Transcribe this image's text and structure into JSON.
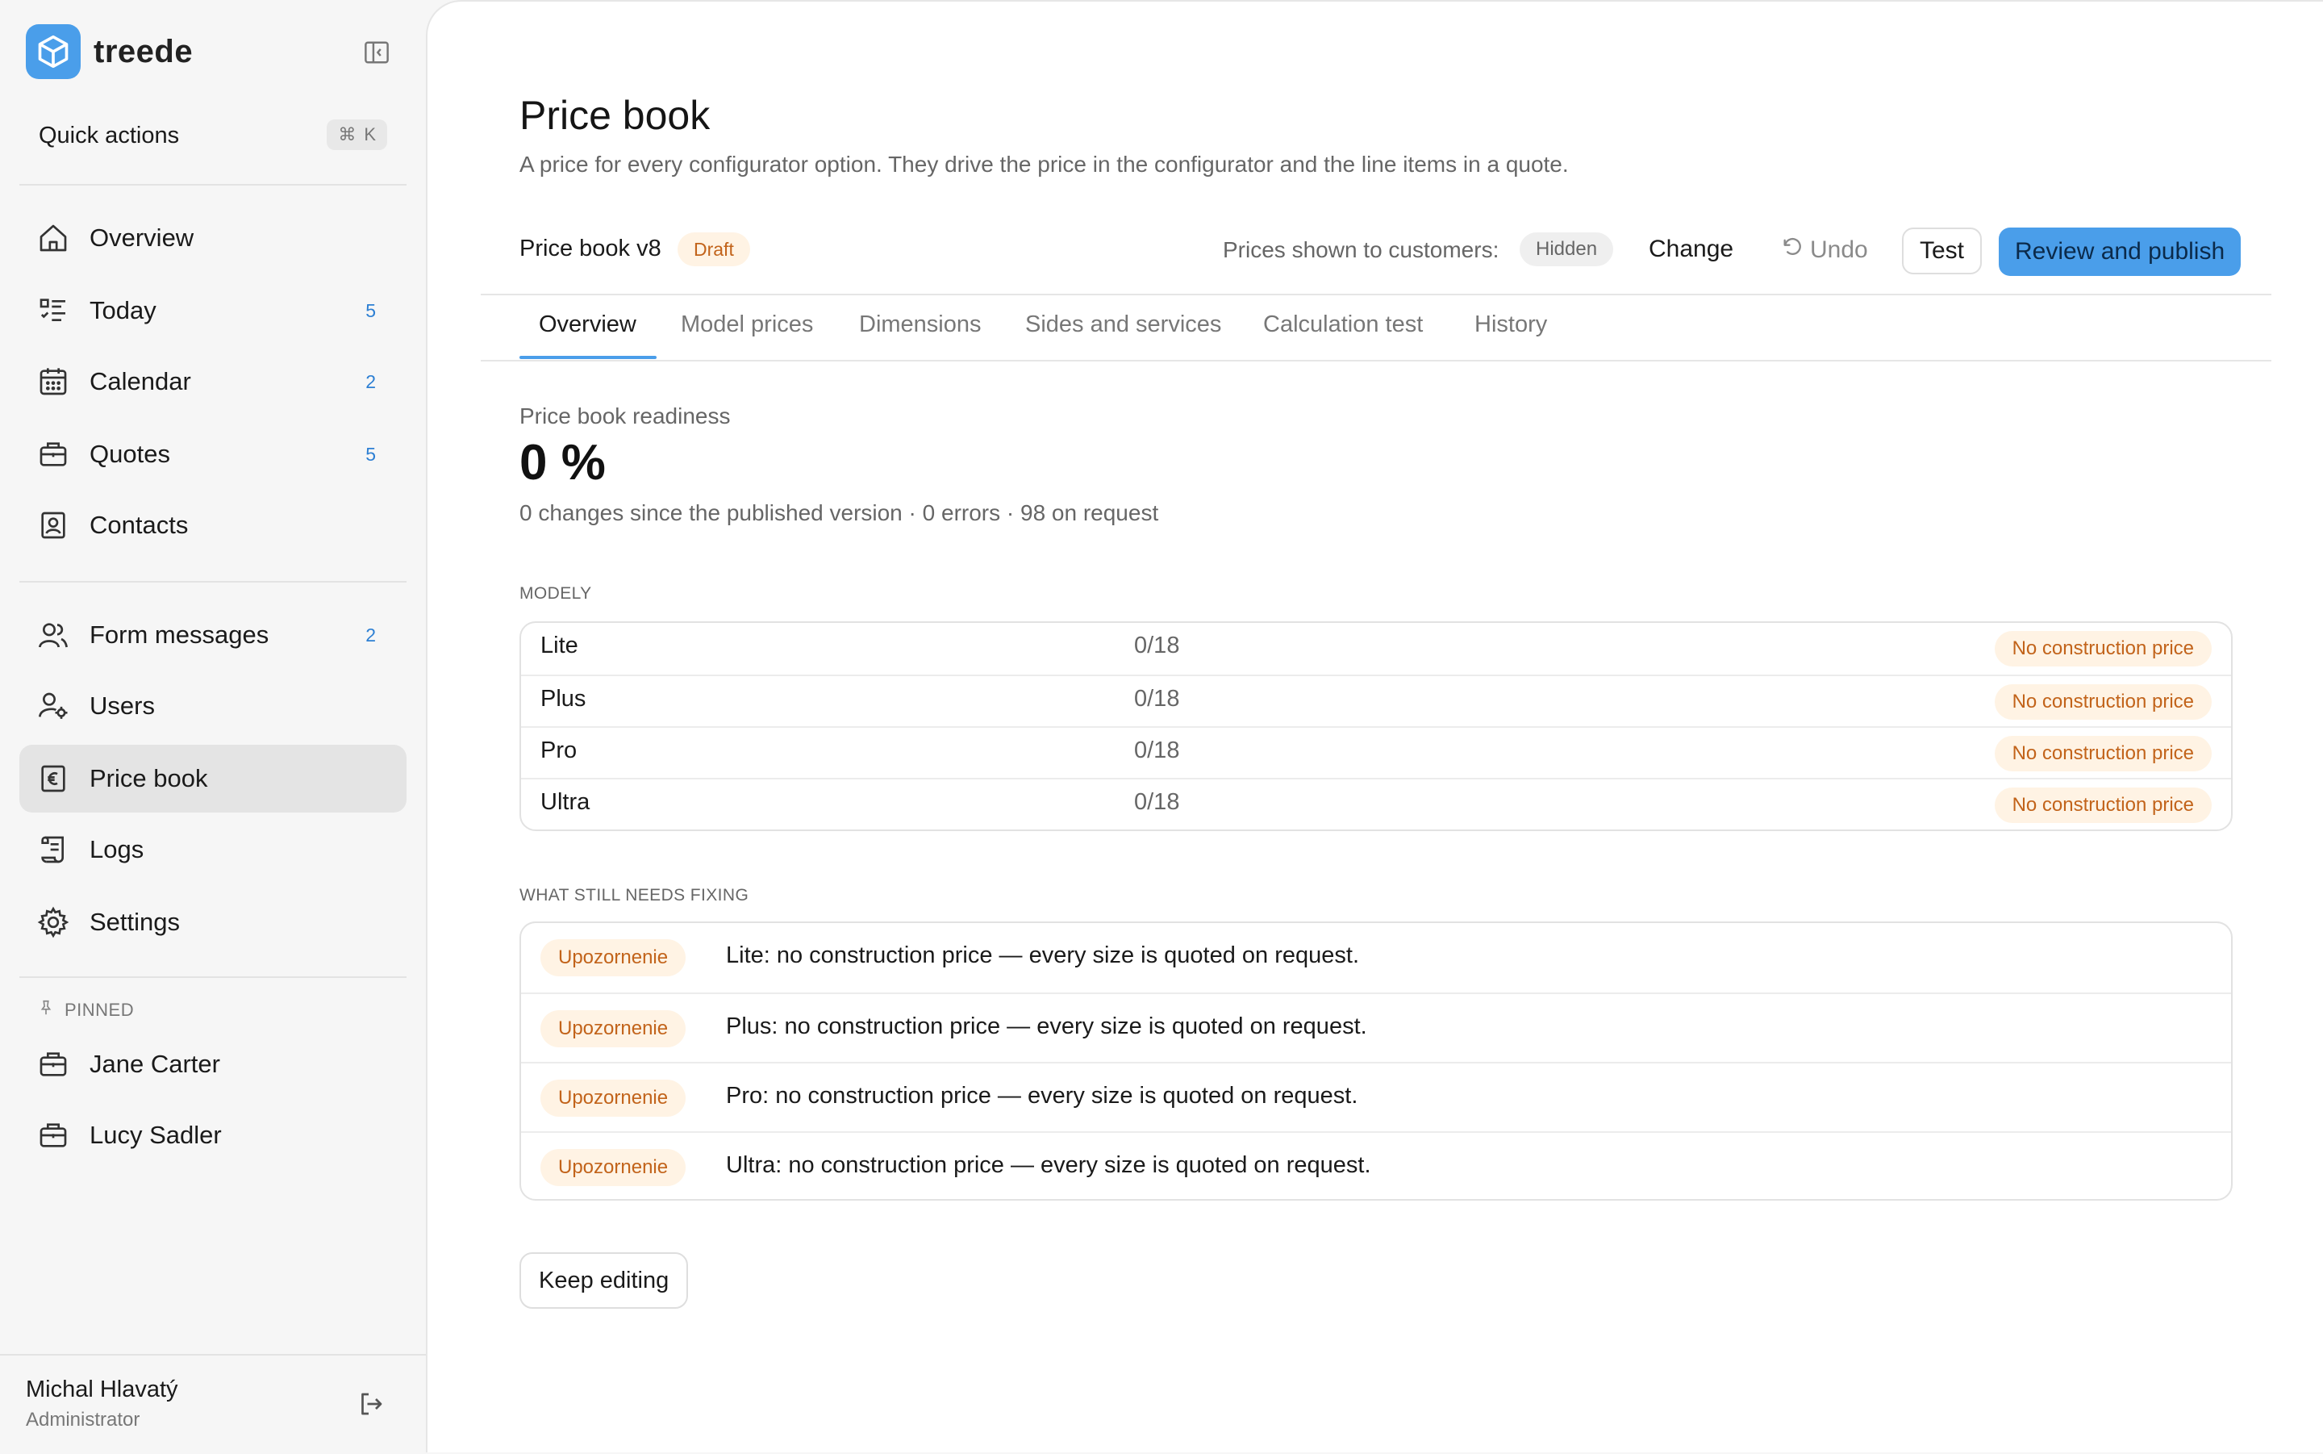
{
  "brand": {
    "name": "treede",
    "accent": "#4a9eea"
  },
  "quick_actions": {
    "label": "Quick actions",
    "shortcut_symbol": "⌘",
    "shortcut_key": "K"
  },
  "nav": {
    "primary": [
      {
        "label": "Overview",
        "icon": "home-icon",
        "badge": ""
      },
      {
        "label": "Today",
        "icon": "checklist-icon",
        "badge": "5"
      },
      {
        "label": "Calendar",
        "icon": "calendar-icon",
        "badge": "2"
      },
      {
        "label": "Quotes",
        "icon": "briefcase-icon",
        "badge": "5"
      },
      {
        "label": "Contacts",
        "icon": "contact-card-icon",
        "badge": ""
      }
    ],
    "secondary": [
      {
        "label": "Form messages",
        "icon": "users-icon",
        "badge": "2"
      },
      {
        "label": "Users",
        "icon": "user-gear-icon",
        "badge": ""
      },
      {
        "label": "Price book",
        "icon": "euro-document-icon",
        "badge": "",
        "active": true
      },
      {
        "label": "Logs",
        "icon": "scroll-icon",
        "badge": ""
      },
      {
        "label": "Settings",
        "icon": "gear-icon",
        "badge": ""
      }
    ],
    "pinned_label": "PINNED",
    "pinned": [
      {
        "label": "Jane Carter",
        "icon": "briefcase-icon"
      },
      {
        "label": "Lucy Sadler",
        "icon": "briefcase-icon"
      }
    ]
  },
  "user": {
    "name": "Michal Hlavatý",
    "role": "Administrator"
  },
  "page": {
    "title": "Price book",
    "subtitle": "A price for every configurator option. They drive the price in the configurator and the line items in a quote."
  },
  "version_bar": {
    "version": "Price book v8",
    "status": "Draft",
    "shown_label": "Prices shown to customers:",
    "shown_value": "Hidden",
    "change": "Change",
    "undo": "Undo",
    "test": "Test",
    "publish": "Review and publish"
  },
  "tabs": [
    "Overview",
    "Model prices",
    "Dimensions",
    "Sides and services",
    "Calculation test",
    "History"
  ],
  "active_tab": "Overview",
  "readiness": {
    "label": "Price book readiness",
    "value": "0 %",
    "meta": "0 changes since the published version · 0 errors · 98 on request"
  },
  "models": {
    "caption": "MODELY",
    "rows": [
      {
        "name": "Lite",
        "count": "0/18",
        "status": "No construction price"
      },
      {
        "name": "Plus",
        "count": "0/18",
        "status": "No construction price"
      },
      {
        "name": "Pro",
        "count": "0/18",
        "status": "No construction price"
      },
      {
        "name": "Ultra",
        "count": "0/18",
        "status": "No construction price"
      }
    ]
  },
  "fixing": {
    "caption": "WHAT STILL NEEDS FIXING",
    "rows": [
      {
        "level": "Upozornenie",
        "text": "Lite: no construction price — every size is quoted on request."
      },
      {
        "level": "Upozornenie",
        "text": "Plus: no construction price — every size is quoted on request."
      },
      {
        "level": "Upozornenie",
        "text": "Pro: no construction price — every size is quoted on request."
      },
      {
        "level": "Upozornenie",
        "text": "Ultra: no construction price — every size is quoted on request."
      }
    ]
  },
  "keep_editing": "Keep editing"
}
